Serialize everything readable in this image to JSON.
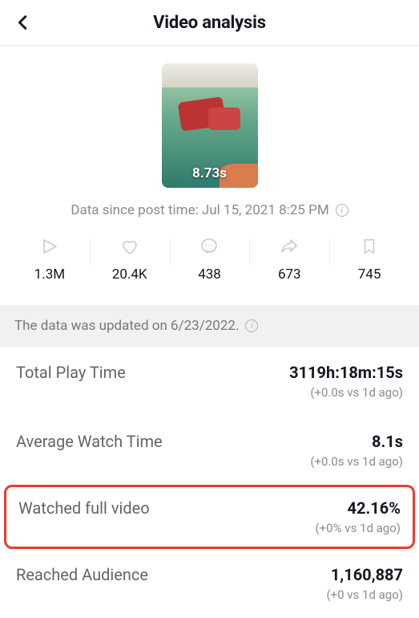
{
  "header": {
    "title": "Video analysis"
  },
  "video": {
    "duration": "8.73s"
  },
  "post_time": "Data since post time: Jul 15, 2021 8:25 PM",
  "stats": {
    "plays": {
      "value": "1.3M"
    },
    "likes": {
      "value": "20.4K"
    },
    "comments": {
      "value": "438"
    },
    "shares": {
      "value": "673"
    },
    "saves": {
      "value": "745"
    }
  },
  "update_bar": "The data was updated on 6/23/2022.",
  "metrics": {
    "total_play_time": {
      "label": "Total Play Time",
      "value": "3119h:18m:15s",
      "delta": "(+0.0s vs 1d ago)"
    },
    "average_watch_time": {
      "label": "Average Watch Time",
      "value": "8.1s",
      "delta": "(+0.0s vs 1d ago)"
    },
    "watched_full_video": {
      "label": "Watched full video",
      "value": "42.16%",
      "delta": "(+0% vs 1d ago)"
    },
    "reached_audience": {
      "label": "Reached Audience",
      "value": "1,160,887",
      "delta": "(+0 vs 1d ago)"
    }
  }
}
